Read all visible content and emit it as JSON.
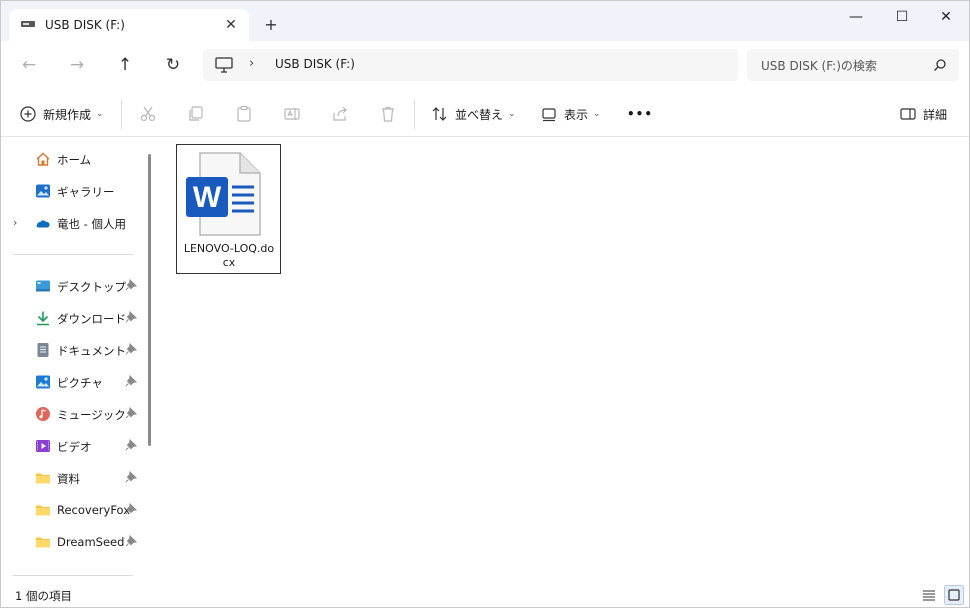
{
  "tab": {
    "title": "USB DISK (F:)",
    "close_label": "✕",
    "new_tab_label": "+"
  },
  "window_controls": {
    "minimize": "—",
    "maximize": "☐",
    "close": "✕"
  },
  "nav": {
    "back": "←",
    "forward": "→",
    "up": "↑",
    "refresh": "↻"
  },
  "address": {
    "separator": "›",
    "path": "USB DISK (F:)"
  },
  "search": {
    "placeholder": "USB DISK (F:)の検索"
  },
  "toolbar": {
    "new_label": "新規作成",
    "sort_label": "並べ替え",
    "view_label": "表示",
    "more_label": "•••",
    "details_label": "詳細"
  },
  "sidebar": {
    "items": [
      {
        "label": "ホーム",
        "icon": "home-icon"
      },
      {
        "label": "ギャラリー",
        "icon": "gallery-icon"
      },
      {
        "label": "竜也 - 個人用",
        "icon": "onedrive-icon"
      },
      {
        "label": "デスクトップ",
        "icon": "desktop-icon"
      },
      {
        "label": "ダウンロード",
        "icon": "download-icon"
      },
      {
        "label": "ドキュメント",
        "icon": "document-icon"
      },
      {
        "label": "ピクチャ",
        "icon": "picture-icon"
      },
      {
        "label": "ミュージック",
        "icon": "music-icon"
      },
      {
        "label": "ビデオ",
        "icon": "video-icon"
      },
      {
        "label": "資料",
        "icon": "folder-icon"
      },
      {
        "label": "RecoveryFox",
        "icon": "folder-icon"
      },
      {
        "label": "DreamSeed",
        "icon": "folder-icon"
      }
    ],
    "expander": "›"
  },
  "files": [
    {
      "name": "LENOVO-LOQ.docx",
      "icon": "word-document-icon"
    }
  ],
  "status": {
    "item_count": "1 個の項目"
  },
  "colors": {
    "accent": "#185abd",
    "folder": "#f5c542",
    "titlebar": "#f0f3f9"
  }
}
